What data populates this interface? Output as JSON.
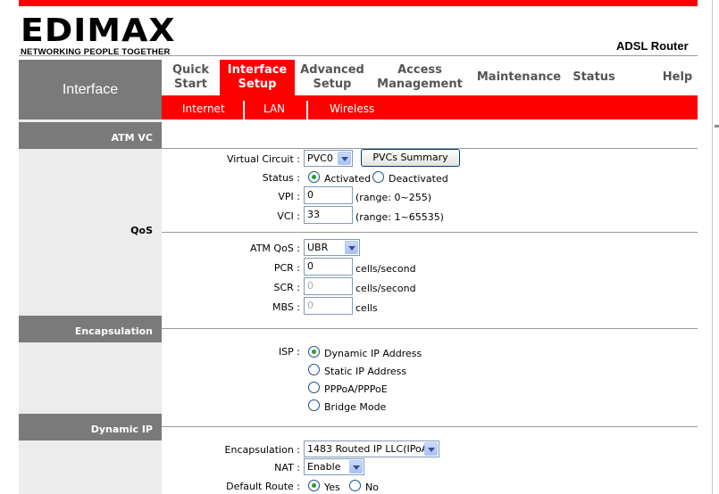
{
  "brand": {
    "logo_text": "EDIMAX",
    "tagline": "NETWORKING PEOPLE TOGETHER",
    "product": "ADSL Router"
  },
  "colors": {
    "accent": "#ff0000",
    "section_gray": "#7a7a7a",
    "sidebar_bg": "#ececec",
    "nav_text": "#555555"
  },
  "sidebar_title": "Interface",
  "nav": [
    {
      "label": "Quick\nStart"
    },
    {
      "label": "Interface\nSetup",
      "active": true
    },
    {
      "label": "Advanced\nSetup"
    },
    {
      "label": "Access\nManagement"
    },
    {
      "label": "Maintenance"
    },
    {
      "label": "Status"
    },
    {
      "label": "Help"
    }
  ],
  "subnav": [
    "Internet",
    "LAN",
    "Wireless"
  ],
  "sections": {
    "atm_vc": "ATM VC",
    "qos": "QoS",
    "encapsulation": "Encapsulation",
    "dynamic_ip": "Dynamic IP"
  },
  "atm": {
    "virtual_circuit_label": "Virtual Circuit :",
    "virtual_circuit_value": "PVC0",
    "pvcs_summary_button": "PVCs Summary",
    "status_label": "Status :",
    "status_activated": "Activated",
    "status_deactivated": "Deactivated",
    "vpi_label": "VPI :",
    "vpi_value": "0",
    "vpi_range": "(range: 0~255)",
    "vci_label": "VCI :",
    "vci_value": "33",
    "vci_range": "(range: 1~65535)"
  },
  "qos": {
    "atm_qos_label": "ATM QoS :",
    "atm_qos_value": "UBR",
    "pcr_label": "PCR :",
    "pcr_value": "0",
    "pcr_unit": "cells/second",
    "scr_label": "SCR :",
    "scr_value": "0",
    "scr_unit": "cells/second",
    "mbs_label": "MBS :",
    "mbs_value": "0",
    "mbs_unit": "cells"
  },
  "encap": {
    "isp_label": "ISP :",
    "options": [
      "Dynamic IP Address",
      "Static IP Address",
      "PPPoA/PPPoE",
      "Bridge Mode"
    ],
    "selected": 0
  },
  "dynip": {
    "encapsulation_label": "Encapsulation :",
    "encapsulation_value": "1483 Routed IP LLC(IPoA)",
    "nat_label": "NAT :",
    "nat_value": "Enable",
    "default_route_label": "Default Route :",
    "default_route_yes": "Yes",
    "default_route_no": "No"
  }
}
